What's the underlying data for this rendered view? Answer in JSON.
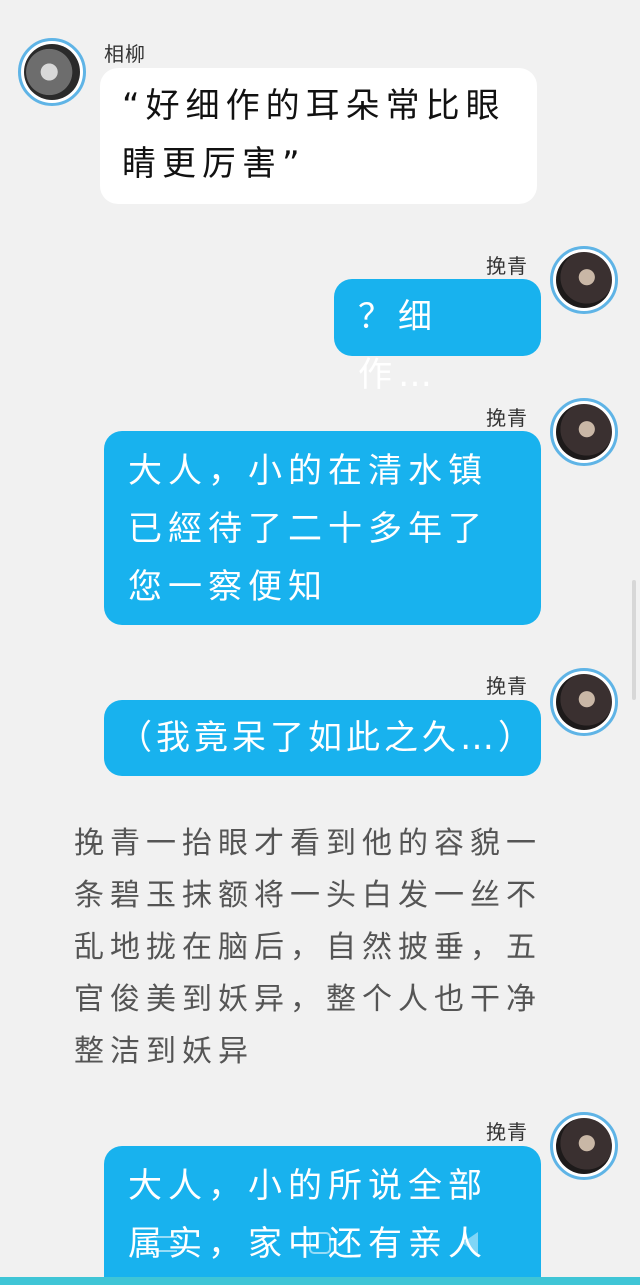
{
  "messages": [
    {
      "side": "left",
      "sender": "相柳",
      "text": "“好细作的耳朵常比眼睛更厉害”"
    },
    {
      "side": "right",
      "sender": "挽青",
      "text": "？细作…"
    },
    {
      "side": "right",
      "sender": "挽青",
      "text": "大人，小的在清水镇已經待了二十多年了您一察便知"
    },
    {
      "side": "right",
      "sender": "挽青",
      "text": "（我竟呆了如此之久…）"
    },
    {
      "side": "right",
      "sender": "挽青",
      "text": "大人，小的所说全部属实，家中还有亲人"
    }
  ],
  "narration": "挽青一抬眼才看到他的容貌一条碧玉抹额将一头白发一丝不乱地拢在脑后，自然披垂，五官俊美到妖异，整个人也干净整洁到妖异",
  "colors": {
    "background": "#f1f1f1",
    "bubble_blue": "#18b2ee",
    "bubble_white": "#ffffff",
    "avatar_ring": "#5fb4e6",
    "nav_bar": "#3fc5d6"
  },
  "icons": [
    "menu-icon",
    "home-icon",
    "back-icon"
  ]
}
